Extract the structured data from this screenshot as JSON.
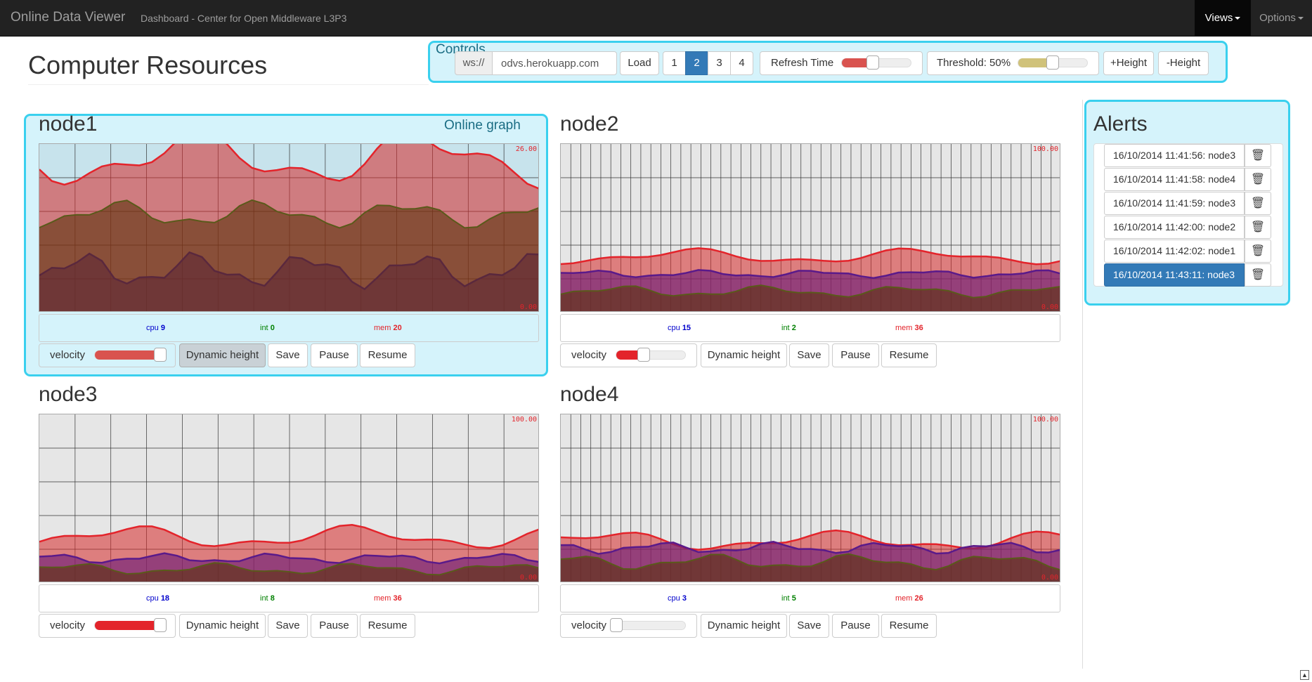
{
  "navbar": {
    "brand": "Online Data Viewer",
    "subtitle": "Dashboard - Center for Open Middleware L3P3",
    "views_label": "Views",
    "options_label": "Options"
  },
  "page_title": "Computer Resources",
  "controls": {
    "title": "Controls",
    "ws_prefix": "ws://",
    "host_value": "odvs.herokuapp.com",
    "load_label": "Load",
    "pages": [
      "1",
      "2",
      "3",
      "4"
    ],
    "active_page": "2",
    "refresh_label": "Refresh Time",
    "threshold_label": "Threshold: 50%",
    "plus_height_label": "+Height",
    "minus_height_label": "-Height",
    "refresh_level": 0.45,
    "threshold_level": 0.5
  },
  "online_graph_label": "Online graph",
  "buttons": {
    "velocity": "velocity",
    "dynamic_height": "Dynamic height",
    "save": "Save",
    "pause": "Pause",
    "resume": "Resume"
  },
  "colors": {
    "cpu": "#0000cc",
    "int": "#008000",
    "mem": "#e3242b",
    "highlight": "#3ad0ee",
    "active": "#337ab7"
  },
  "nodes": [
    {
      "name": "node1",
      "max_label": "26.00",
      "min_label": "0.00",
      "cpu_label": "cpu",
      "cpu": "9",
      "int_label": "int",
      "int": "0",
      "mem_label": "mem",
      "mem": "20",
      "velocity_level": 0.95
    },
    {
      "name": "node2",
      "max_label": "100.00",
      "min_label": "0.00",
      "cpu_label": "cpu",
      "cpu": "15",
      "int_label": "int",
      "int": "2",
      "mem_label": "mem",
      "mem": "36",
      "velocity_level": 0.4
    },
    {
      "name": "node3",
      "max_label": "100.00",
      "min_label": "0.00",
      "cpu_label": "cpu",
      "cpu": "18",
      "int_label": "int",
      "int": "8",
      "mem_label": "mem",
      "mem": "36",
      "velocity_level": 0.95
    },
    {
      "name": "node4",
      "max_label": "100.00",
      "min_label": "0.00",
      "cpu_label": "cpu",
      "cpu": "3",
      "int_label": "int",
      "int": "5",
      "mem_label": "mem",
      "mem": "26",
      "velocity_level": 0.0
    }
  ],
  "alerts": {
    "title": "Alerts",
    "items": [
      "16/10/2014 11:41:56: node3",
      "16/10/2014 11:41:58: node4",
      "16/10/2014 11:41:59: node3",
      "16/10/2014 11:42:00: node2",
      "16/10/2014 11:42:02: node1",
      "16/10/2014 11:43:11: node3"
    ],
    "active_index": 5,
    "delete_icon": "trash-icon"
  }
}
